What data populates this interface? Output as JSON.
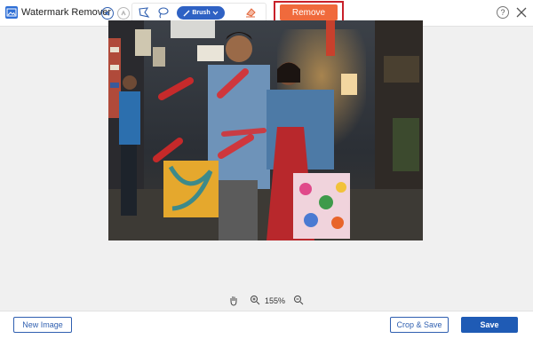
{
  "window": {
    "title": "Watermark Remover"
  },
  "toolbar": {
    "brush_label": "Brush",
    "remove_label": "Remove",
    "help_glyph": "?"
  },
  "icons": {
    "logo": "app-logo-icon",
    "undo": "undo-icon",
    "redo": "redo-icon",
    "polygon": "polygonal-lasso-icon",
    "lasso": "lasso-icon",
    "brush": "brush-icon",
    "eraser": "eraser-icon",
    "help": "help-icon",
    "close": "close-icon",
    "hand": "hand-icon",
    "zoom_in": "zoom-in-icon",
    "zoom_out": "zoom-out-icon"
  },
  "zoom": {
    "level": "155%"
  },
  "footer": {
    "new_image_label": "New Image",
    "crop_save_label": "Crop & Save",
    "save_label": "Save"
  },
  "colors": {
    "accent_blue": "#2f62c4",
    "remove_orange": "#f06a3c",
    "highlight_red": "#c8202a",
    "brush_mark_red": "#e02828"
  }
}
